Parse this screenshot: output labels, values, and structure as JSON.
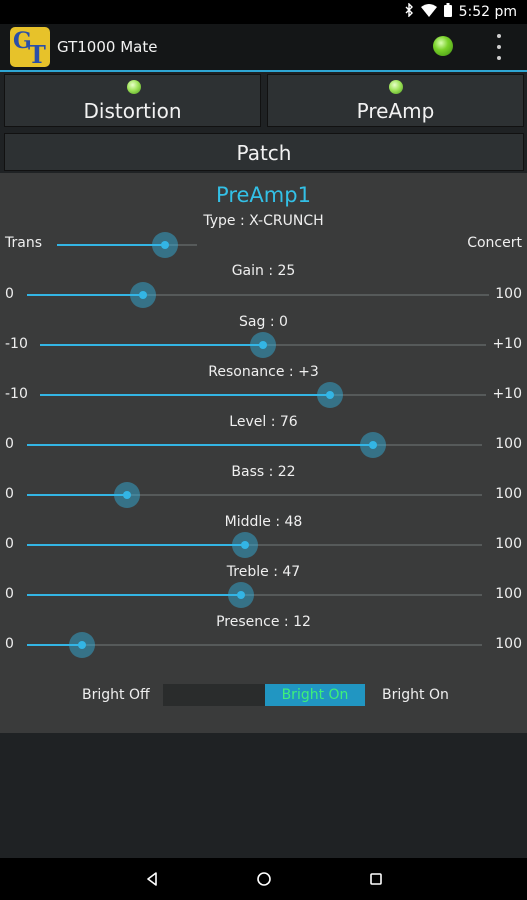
{
  "status_bar": {
    "time": "5:52 pm"
  },
  "app": {
    "title": "GT1000 Mate"
  },
  "tabs": [
    {
      "label": "Distortion"
    },
    {
      "label": "PreAmp"
    }
  ],
  "patch": {
    "label": "Patch"
  },
  "preamp": {
    "name": "PreAmp1",
    "type_label": "Type : X-CRUNCH",
    "sliders": [
      {
        "label": "",
        "min": "Trans",
        "max": "Concert",
        "fraction": 0.77
      },
      {
        "label": "Gain : 25",
        "min": "0",
        "max": "100",
        "fraction": 0.25
      },
      {
        "label": "Sag : 0",
        "min": "-10",
        "max": "+10",
        "fraction": 0.5
      },
      {
        "label": "Resonance : +3",
        "min": "-10",
        "max": "+10",
        "fraction": 0.65
      },
      {
        "label": "Level : 76",
        "min": "0",
        "max": "100",
        "fraction": 0.76
      },
      {
        "label": "Bass : 22",
        "min": "0",
        "max": "100",
        "fraction": 0.22
      },
      {
        "label": "Middle : 48",
        "min": "0",
        "max": "100",
        "fraction": 0.48
      },
      {
        "label": "Treble : 47",
        "min": "0",
        "max": "100",
        "fraction": 0.47
      },
      {
        "label": "Presence : 12",
        "min": "0",
        "max": "100",
        "fraction": 0.12
      }
    ],
    "bright": {
      "off_label": "Bright Off",
      "toggle_label": "Bright On",
      "on_label": "Bright On",
      "state": "on"
    }
  },
  "colors": {
    "accent": "#33b5e5",
    "patch_name": "#33c0e6",
    "led": "#7ad22a",
    "toggle_text": "#3ef07a"
  },
  "icons": {
    "status": [
      "bluetooth-icon",
      "wifi-icon",
      "battery-icon"
    ],
    "nav": [
      "back-icon",
      "home-icon",
      "recents-icon"
    ],
    "menu": "overflow-menu-icon"
  }
}
